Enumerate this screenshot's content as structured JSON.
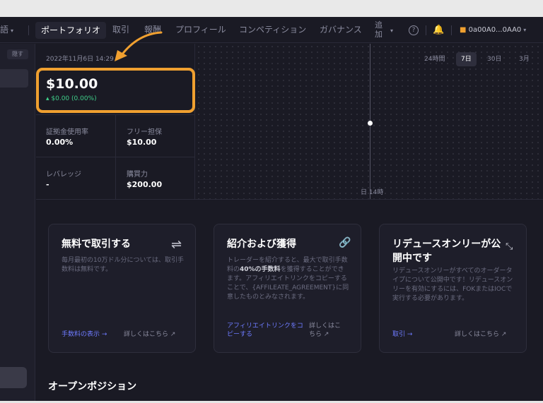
{
  "nav": {
    "language": "語",
    "portfolio": "ポートフォリオ",
    "trade": "取引",
    "rewards": "報酬",
    "profile": "プロフィール",
    "competition": "コンペティション",
    "governance": "ガバナンス",
    "more_1": "追",
    "more_2": "加",
    "help_glyph": "?",
    "wallet": "0a00A0...0AA0"
  },
  "sidebar": {
    "hide_label": "隠す"
  },
  "account": {
    "timestamp": "2022年11月6日 14:29",
    "equity": "$10.00",
    "change": "▴ $0.00 (0.00%)",
    "stats": [
      {
        "label": "証拠金使用率",
        "value": "0.00%"
      },
      {
        "label": "フリー担保",
        "value": "$10.00"
      },
      {
        "label": "レバレッジ",
        "value": "-"
      },
      {
        "label": "購買力",
        "value": "$200.00"
      }
    ]
  },
  "chart": {
    "ranges": [
      "24時間",
      "7日",
      "30日",
      "3月"
    ],
    "active_range": "7日",
    "hover_date": "日 14時"
  },
  "cards": [
    {
      "title": "無料で取引する",
      "icon": "swap-icon",
      "body": "毎月最初の10万ドル分については、取引手数料は無料です。",
      "link": "手数料の表示 →",
      "more": "詳しくはこちら ↗"
    },
    {
      "title": "紹介および獲得",
      "icon": "link-icon",
      "body_pre": "トレーダーを紹介すると、最大で取引手数料の",
      "body_bold": "40%の手数料",
      "body_post": "を獲得することができます。アフィリエイトリンクをコピーすることで、{AFFILEATE_AGREEMENT}に同意したものとみなされます。",
      "link": "アフィリエイトリンクをコピーする",
      "more": "詳しくはこちら ↗"
    },
    {
      "title": "リデュースオンリーが公開中です",
      "icon": "collapse-icon",
      "body": "リデュースオンリーがすべてのオーダータイプについて公開中です！リデュースオンリーを有効にするには、FOKまたはIOCで実行する必要があります。",
      "link": "取引 →",
      "more": "詳しくはこちら ↗"
    }
  ],
  "open_positions": "オープンポジション",
  "colors": {
    "accent": "#f0a030",
    "positive": "#3fd08a",
    "link": "#6e7bff",
    "background": "#1a1a24"
  }
}
